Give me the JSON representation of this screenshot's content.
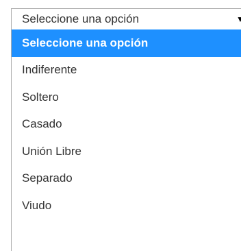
{
  "select": {
    "value": "Seleccione una opción",
    "arrow_icon": "caret-down-icon"
  },
  "options": [
    {
      "label": "Seleccione una opción",
      "selected": true
    },
    {
      "label": "Indiferente",
      "selected": false
    },
    {
      "label": "Soltero",
      "selected": false
    },
    {
      "label": "Casado",
      "selected": false
    },
    {
      "label": "Unión Libre",
      "selected": false
    },
    {
      "label": "Separado",
      "selected": false
    },
    {
      "label": "Viudo",
      "selected": false
    }
  ],
  "colors": {
    "highlight": "#1e90ff",
    "text": "#333333",
    "border": "#adadad"
  }
}
